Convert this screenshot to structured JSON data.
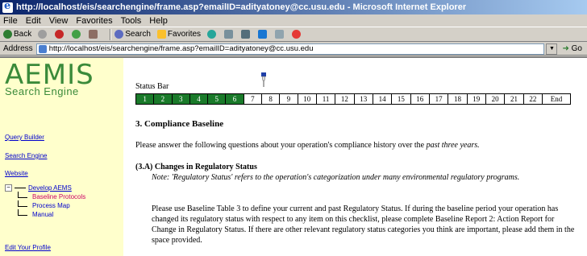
{
  "window": {
    "title": "http://localhost/eis/searchengine/frame.asp?emailID=adityatoney@cc.usu.edu - Microsoft Internet Explorer"
  },
  "menu": [
    "File",
    "Edit",
    "View",
    "Favorites",
    "Tools",
    "Help"
  ],
  "toolbar": {
    "back": "Back",
    "search": "Search",
    "favorites": "Favorites"
  },
  "address": {
    "label": "Address",
    "url": "http://localhost/eis/searchengine/frame.asp?emailID=adityatoney@cc.usu.edu",
    "go": "Go"
  },
  "sidebar": {
    "logo_big": "AEMIS",
    "logo_small": "Search Engine",
    "links": [
      "Query Builder",
      "Search Engine",
      "Website"
    ],
    "tree_root": "Develop AEMS",
    "tree_children": [
      "Baseline Protocols",
      "Process Map",
      "Manual"
    ],
    "bottom_link": "Edit Your Profile"
  },
  "statusbar": {
    "label": "Status Bar",
    "cells": [
      "1",
      "2",
      "3",
      "4",
      "5",
      "6",
      "7",
      "8",
      "9",
      "10",
      "11",
      "12",
      "13",
      "14",
      "15",
      "16",
      "17",
      "18",
      "19",
      "20",
      "21",
      "22",
      "End"
    ],
    "completed_count": 6
  },
  "section": {
    "heading": "3. Compliance Baseline",
    "intro": "Please answer the following questions about your operation's compliance history over the",
    "intro_em": "past three years.",
    "sub_heading": "(3.A) Changes in Regulatory Status",
    "note": "Note: 'Regulatory Status' refers to the operation's categorization under many environmental regulatory programs.",
    "body": "Please use Baseline Table 3 to define your current and past Regulatory Status. If during the baseline period your operation has changed its regulatory status with respect to any item on this checklist, please complete Baseline Report 2: Action Report for Change in Regulatory Status. If there are other relevant regulatory status categories you think are important, please add them in the space provided."
  },
  "colors": {
    "done": "#1a7a2a",
    "logo": "#3a8a3a",
    "sidebar_bg": "#ffffcc",
    "link": "#0000cc",
    "active_link": "#cc0066"
  }
}
